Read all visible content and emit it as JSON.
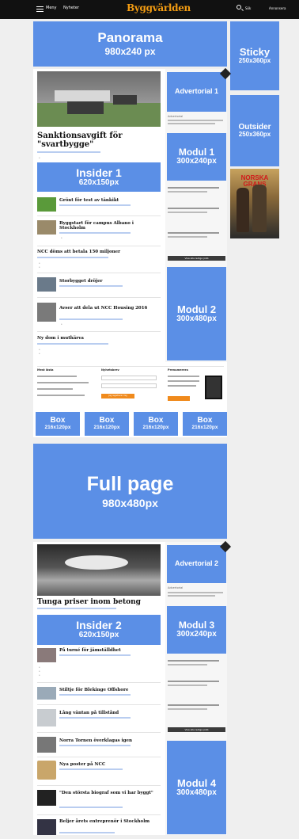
{
  "topbar": {
    "menu": "Meny",
    "news": "Nyheter",
    "logo": "Byggvärlden",
    "search": "Sök",
    "advertise": "Annonsera"
  },
  "ads": {
    "panorama": {
      "name": "Panorama",
      "size": "980x240 px"
    },
    "sticky": {
      "name": "Sticky",
      "size": "250x360px"
    },
    "outsider": {
      "name": "Outsider",
      "size": "250x360px"
    },
    "advertorial1": {
      "name": "Advertorial 1"
    },
    "modul1": {
      "name": "Modul 1",
      "size": "300x240px"
    },
    "insider1": {
      "name": "Insider 1",
      "size": "620x150px"
    },
    "modul2": {
      "name": "Modul 2",
      "size": "300x480px"
    },
    "box": [
      {
        "name": "Box",
        "size": "216x120px"
      },
      {
        "name": "Box",
        "size": "216x120px"
      },
      {
        "name": "Box",
        "size": "216x120px"
      },
      {
        "name": "Box",
        "size": "216x120px"
      }
    ],
    "fullpage": {
      "name": "Full page",
      "size": "980x480px"
    },
    "advertorial2": {
      "name": "Advertorial 2"
    },
    "modul3": {
      "name": "Modul 3",
      "size": "300x240px"
    },
    "insider2": {
      "name": "Insider 2",
      "size": "620x150px"
    },
    "modul4": {
      "name": "Modul 4",
      "size": "300x480px"
    }
  },
  "section1": {
    "headline": "Sanktionsavgift för \"svartbygge\"",
    "articles": [
      {
        "title": "Grönt för test av tänkikt"
      },
      {
        "title": "Byggstart för campus Albano i Stockholm"
      },
      {
        "title": "NCC döms att betala 150 miljoner"
      },
      {
        "title": "Storbygget dröjer"
      },
      {
        "title": "Avser att dela ut NCC Housing 2016"
      },
      {
        "title": "Ny dom i muthärva"
      }
    ],
    "rail_label": "Advertorial",
    "rail_button": "Visa alla lediga jobb"
  },
  "footer": {
    "col1_title": "Mest lästa",
    "col2_title": "Nyhetsbrev",
    "col3_title": "Prenumerera",
    "signup": "Jag registrerar mig"
  },
  "section2": {
    "headline": "Tunga priser inom betong",
    "articles": [
      {
        "title": "På turné för jämställdhet"
      },
      {
        "title": "Stiltje för Blekinge Offshore"
      },
      {
        "title": "Lång väntan på tillstånd"
      },
      {
        "title": "Norra Tornen överklagas igen"
      },
      {
        "title": "Nya poster på NCC"
      },
      {
        "title": "\"Den största biograf som vi har byggt\""
      },
      {
        "title": "Beljer årets entreprenör i Stockholm"
      }
    ],
    "rail_label": "Advertorial",
    "rail_button": "Visa alla lediga jobb"
  },
  "poster": {
    "title": "NORSKA GRANS"
  }
}
